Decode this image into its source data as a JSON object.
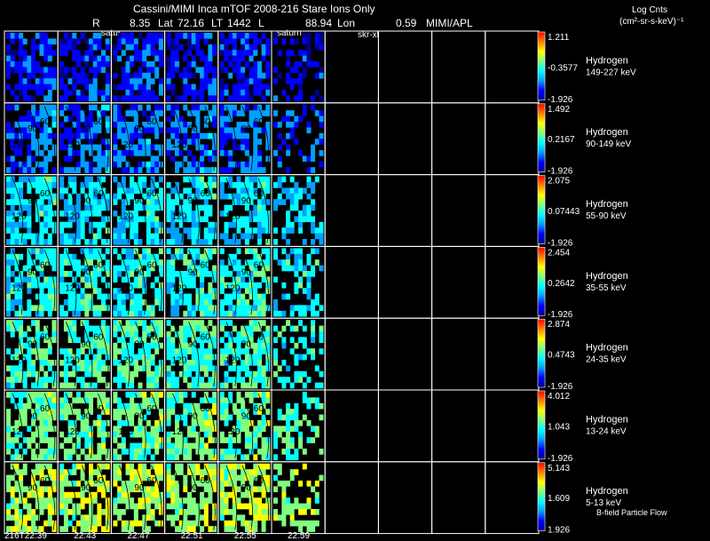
{
  "header": {
    "title": "Cassini/MIMI Inca mTOF  2008-216   Stare    Ions Only",
    "r_label": "R",
    "r_value": "8.35",
    "lat_label": "Lat",
    "lat_value": "72.16",
    "lt_label": "LT",
    "lt_value": "1442",
    "l_label": "L",
    "lon_value": "88.94",
    "lon_label": "Lon",
    "extra_value": "0.59",
    "org": "MIMI/APL",
    "units_line1": "Log Cnts",
    "units_line2": "(cm²-sr-s-keV)⁻¹",
    "overlay_labels": [
      "satur",
      "saturn",
      "skr-xl"
    ]
  },
  "footer": {
    "times": [
      "216T22:39",
      "22:43",
      "22:47",
      "22:51",
      "22:55",
      "22:59"
    ],
    "note": "B-field Particle Flow"
  },
  "chart_data": {
    "type": "heatmap",
    "title": "Cassini/MIMI Inca mTOF  2008-216   Stare    Ions Only",
    "colormap": [
      "#00008b",
      "#0000ff",
      "#00a0ff",
      "#00ffff",
      "#80ff80",
      "#ffff00",
      "#ff8000",
      "#ff0000"
    ],
    "columns": 10,
    "time_labels": [
      "216T22:39",
      "22:43",
      "22:47",
      "22:51",
      "22:55",
      "22:59"
    ],
    "contour_labels": [
      "120",
      "90",
      "60"
    ],
    "rows": [
      {
        "species": "Hydrogen",
        "energy": "149-227 keV",
        "max": "1.211",
        "mid": "-0.3577",
        "min": "-1.926",
        "level": 0.12
      },
      {
        "species": "Hydrogen",
        "energy": "90-149 keV",
        "max": "1.492",
        "mid": "0.2167",
        "min": "-1.926",
        "level": 0.2
      },
      {
        "species": "Hydrogen",
        "energy": "55-90 keV",
        "max": "2.075",
        "mid": "0.07443",
        "min": "-1.926",
        "level": 0.35
      },
      {
        "species": "Hydrogen",
        "energy": "35-55 keV",
        "max": "2.454",
        "mid": "0.2642",
        "min": "-1.926",
        "level": 0.4
      },
      {
        "species": "Hydrogen",
        "energy": "24-35 keV",
        "max": "2.874",
        "mid": "0.4743",
        "min": "-1.926",
        "level": 0.45
      },
      {
        "species": "Hydrogen",
        "energy": "13-24 keV",
        "max": "4.012",
        "mid": "1.043",
        "min": "-1.926",
        "level": 0.5
      },
      {
        "species": "Hydrogen",
        "energy": "5-13 keV",
        "max": "5.143",
        "mid": "1.609",
        "min": "1.926",
        "level": 0.58
      }
    ]
  }
}
